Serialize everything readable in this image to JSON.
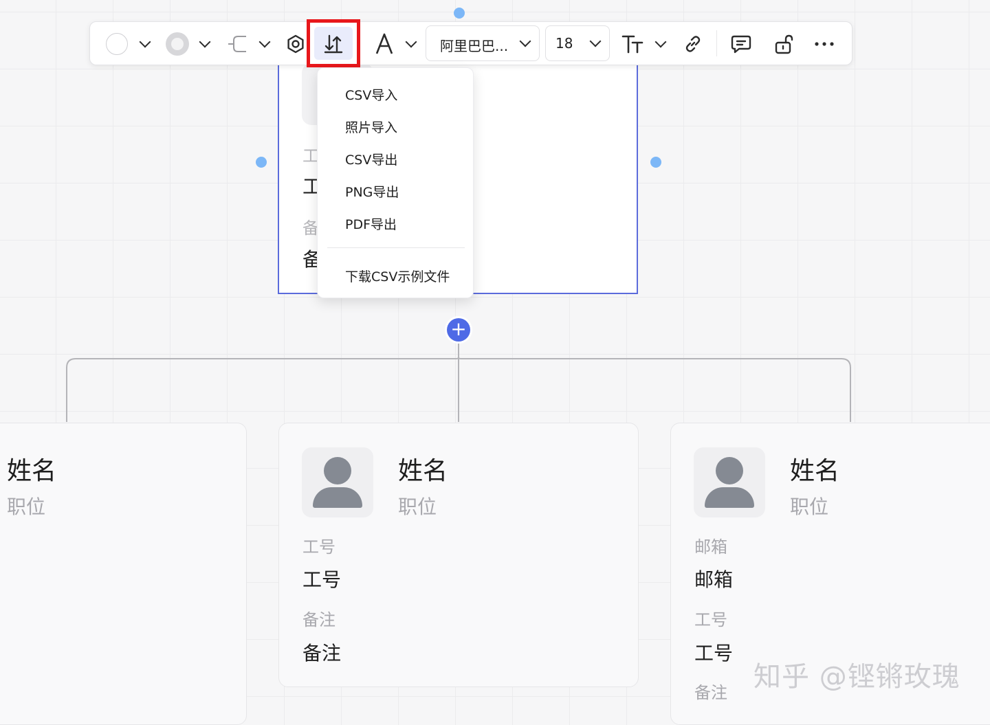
{
  "toolbar": {
    "font_family": "阿里巴巴...",
    "font_size": "18",
    "export_icon": "import-export-icon",
    "icons": [
      "fill-color-icon",
      "border-color-icon",
      "connector-style-icon",
      "settings-icon",
      "import-export-icon",
      "text-color-icon",
      "text-size-icon",
      "link-icon",
      "comment-icon",
      "lock-icon",
      "more-icon"
    ]
  },
  "menu": {
    "items": [
      "CSV导入",
      "照片导入",
      "CSV导出",
      "PNG导出",
      "PDF导出"
    ],
    "footer": "下载CSV示例文件"
  },
  "selected_card": {
    "label1_partial": "工",
    "value1_partial": "工",
    "label2_partial": "备",
    "value2_partial": "备"
  },
  "cards": {
    "left": {
      "name": "姓名",
      "role": "职位"
    },
    "middle": {
      "name": "姓名",
      "role": "职位",
      "field1_label": "工号",
      "field1_value": "工号",
      "field2_label": "备注",
      "field2_value": "备注"
    },
    "right": {
      "name": "姓名",
      "role": "职位",
      "field1_label": "邮箱",
      "field1_value": "邮箱",
      "field2_label": "工号",
      "field2_value": "工号",
      "field3_label": "备注"
    }
  },
  "add_button": "+",
  "watermark": "知乎 @铿锵玫瑰",
  "colors": {
    "accent": "#4e6ae6",
    "selection": "#5b6bdc",
    "highlight": "#e8171b",
    "handle": "#7cb7f7"
  }
}
